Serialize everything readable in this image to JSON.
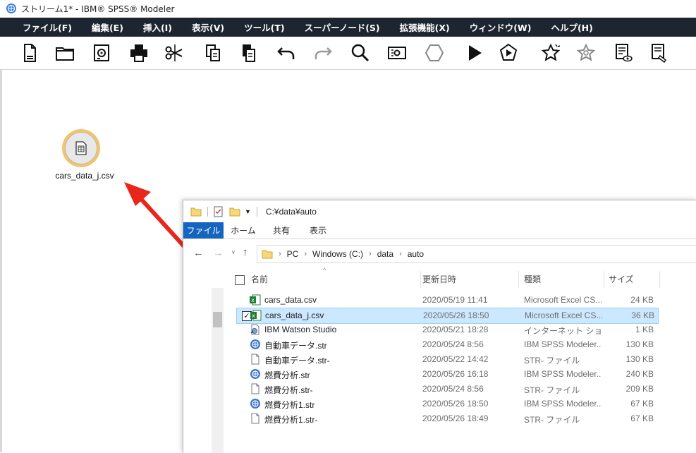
{
  "window": {
    "title": "ストリーム1* - IBM® SPSS® Modeler"
  },
  "menu": [
    "ファイル(F)",
    "編集(E)",
    "挿入(I)",
    "表示(V)",
    "ツール(T)",
    "スーパーノード(S)",
    "拡張機能(X)",
    "ウィンドウ(W)",
    "ヘルプ(H)"
  ],
  "toolbar_icons": [
    "new-stream-icon",
    "open-folder-icon",
    "save-icon",
    "print-icon",
    "cut-icon",
    "copy-icon",
    "paste-icon",
    "undo-icon",
    "redo-icon",
    "search-icon",
    "stream-properties-icon",
    "supernode-icon",
    "run-icon",
    "run-selection-icon",
    "favorite-icon",
    "favorite-settings-icon",
    "preview-icon",
    "annotation-icon"
  ],
  "canvas": {
    "node_label": "cars_data_j.csv"
  },
  "explorer": {
    "path": "C:¥data¥auto",
    "ribbon_tabs": [
      "ファイル",
      "ホーム",
      "共有",
      "表示"
    ],
    "breadcrumb": [
      "PC",
      "Windows (C:)",
      "data",
      "auto"
    ],
    "columns": {
      "name": "名前",
      "date": "更新日時",
      "type": "種類",
      "size": "サイズ"
    },
    "files": [
      {
        "name": "cars_data.csv",
        "date": "2020/05/19 11:41",
        "type": "Microsoft Excel CS...",
        "size": "24 KB",
        "icon": "excel-csv-icon",
        "selected": false
      },
      {
        "name": "cars_data_j.csv",
        "date": "2020/05/26 18:50",
        "type": "Microsoft Excel CS...",
        "size": "36 KB",
        "icon": "excel-csv-icon",
        "selected": true
      },
      {
        "name": "IBM Watson Studio",
        "date": "2020/05/21 18:28",
        "type": "インターネット ショート...",
        "size": "1 KB",
        "icon": "internet-shortcut-icon",
        "selected": false
      },
      {
        "name": "自動車データ.str",
        "date": "2020/05/24 8:56",
        "type": "IBM SPSS Modeler...",
        "size": "130 KB",
        "icon": "spss-stream-icon",
        "selected": false
      },
      {
        "name": "自動車データ.str-",
        "date": "2020/05/22 14:42",
        "type": "STR- ファイル",
        "size": "130 KB",
        "icon": "blank-file-icon",
        "selected": false
      },
      {
        "name": "燃費分析.str",
        "date": "2020/05/26 16:18",
        "type": "IBM SPSS Modeler...",
        "size": "240 KB",
        "icon": "spss-stream-icon",
        "selected": false
      },
      {
        "name": "燃費分析.str-",
        "date": "2020/05/24 8:56",
        "type": "STR- ファイル",
        "size": "209 KB",
        "icon": "blank-file-icon",
        "selected": false
      },
      {
        "name": "燃費分析1.str",
        "date": "2020/05/26 18:50",
        "type": "IBM SPSS Modeler...",
        "size": "67 KB",
        "icon": "spss-stream-icon",
        "selected": false
      },
      {
        "name": "燃費分析1.str-",
        "date": "2020/05/26 18:49",
        "type": "STR- ファイル",
        "size": "67 KB",
        "icon": "blank-file-icon",
        "selected": false
      }
    ]
  },
  "colors": {
    "menubar": "#1d2530",
    "node_ring": "#f4c36b",
    "arrow": "#e8261c",
    "ribbon_file": "#1565c0",
    "selection": "#cce8ff"
  }
}
